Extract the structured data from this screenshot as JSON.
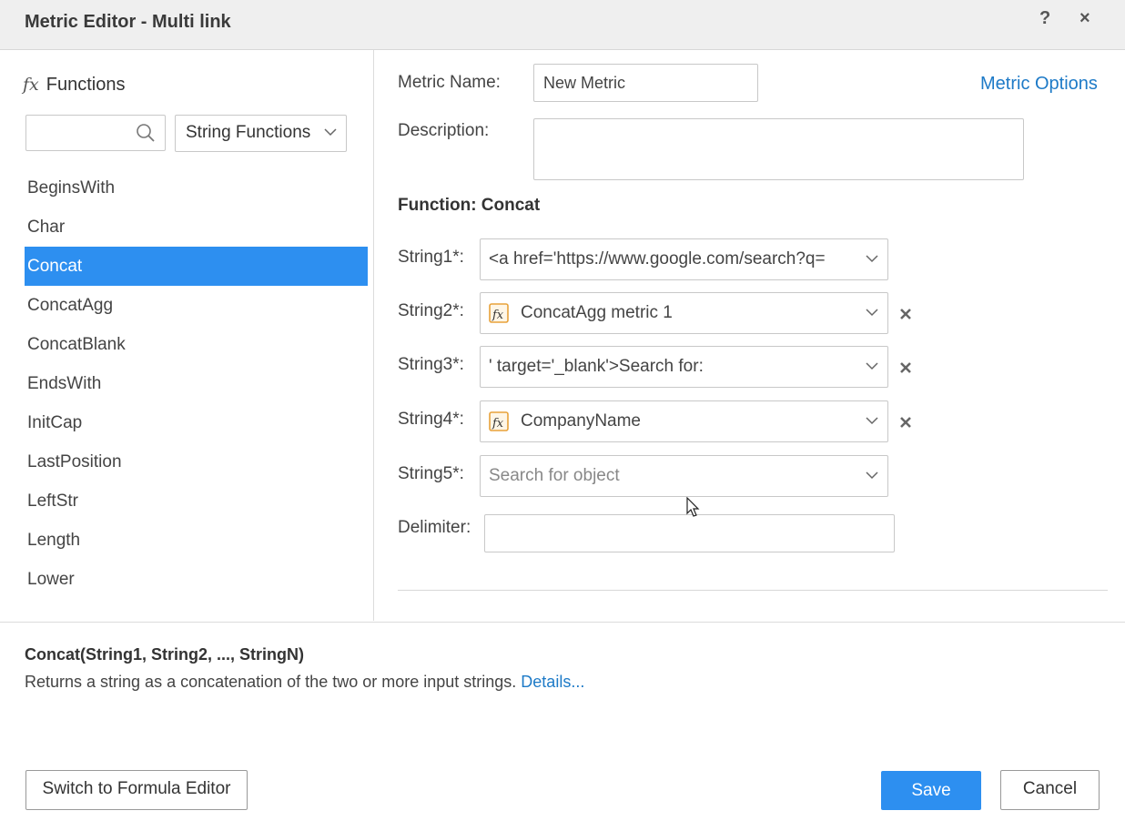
{
  "dialog": {
    "title": "Metric Editor - Multi link",
    "help_label": "?",
    "close_label": "×"
  },
  "functions_panel": {
    "header_icon": "fx",
    "header_label": "Functions",
    "search_value": "",
    "category": "String Functions",
    "items": [
      {
        "label": "BeginsWith",
        "selected": false
      },
      {
        "label": "Char",
        "selected": false
      },
      {
        "label": "Concat",
        "selected": true
      },
      {
        "label": "ConcatAgg",
        "selected": false
      },
      {
        "label": "ConcatBlank",
        "selected": false
      },
      {
        "label": "EndsWith",
        "selected": false
      },
      {
        "label": "InitCap",
        "selected": false
      },
      {
        "label": "LastPosition",
        "selected": false
      },
      {
        "label": "LeftStr",
        "selected": false
      },
      {
        "label": "Length",
        "selected": false
      },
      {
        "label": "Lower",
        "selected": false
      }
    ]
  },
  "editor": {
    "metric_name_label": "Metric Name:",
    "metric_name_value": "New Metric",
    "metric_options_label": "Metric Options",
    "description_label": "Description:",
    "description_value": "",
    "function_title": "Function: Concat",
    "arguments": [
      {
        "label": "String1*:",
        "value": "<a href='https://www.google.com/search?q=",
        "object_icon": false,
        "removable": false
      },
      {
        "label": "String2*:",
        "value": "ConcatAgg metric 1",
        "object_icon": true,
        "removable": true
      },
      {
        "label": "String3*:",
        "value": "' target='_blank'>Search for:",
        "object_icon": false,
        "removable": true
      },
      {
        "label": "String4*:",
        "value": "CompanyName",
        "object_icon": true,
        "removable": true
      },
      {
        "label": "String5*:",
        "value": "",
        "placeholder": "Search for object",
        "object_icon": false,
        "removable": false
      }
    ],
    "delimiter_label": "Delimiter:",
    "delimiter_value": ""
  },
  "footer": {
    "syntax": "Concat(String1, String2, ..., StringN)",
    "description": "Returns a string as a concatenation of the two or more input strings.",
    "details_link": "Details...",
    "switch_button": "Switch to Formula Editor",
    "save_button": "Save",
    "cancel_button": "Cancel"
  },
  "colors": {
    "accent": "#2d8ff0",
    "link": "#1d7ac7",
    "titlebar_bg": "#efefef",
    "object_icon": "#e8a23a"
  }
}
